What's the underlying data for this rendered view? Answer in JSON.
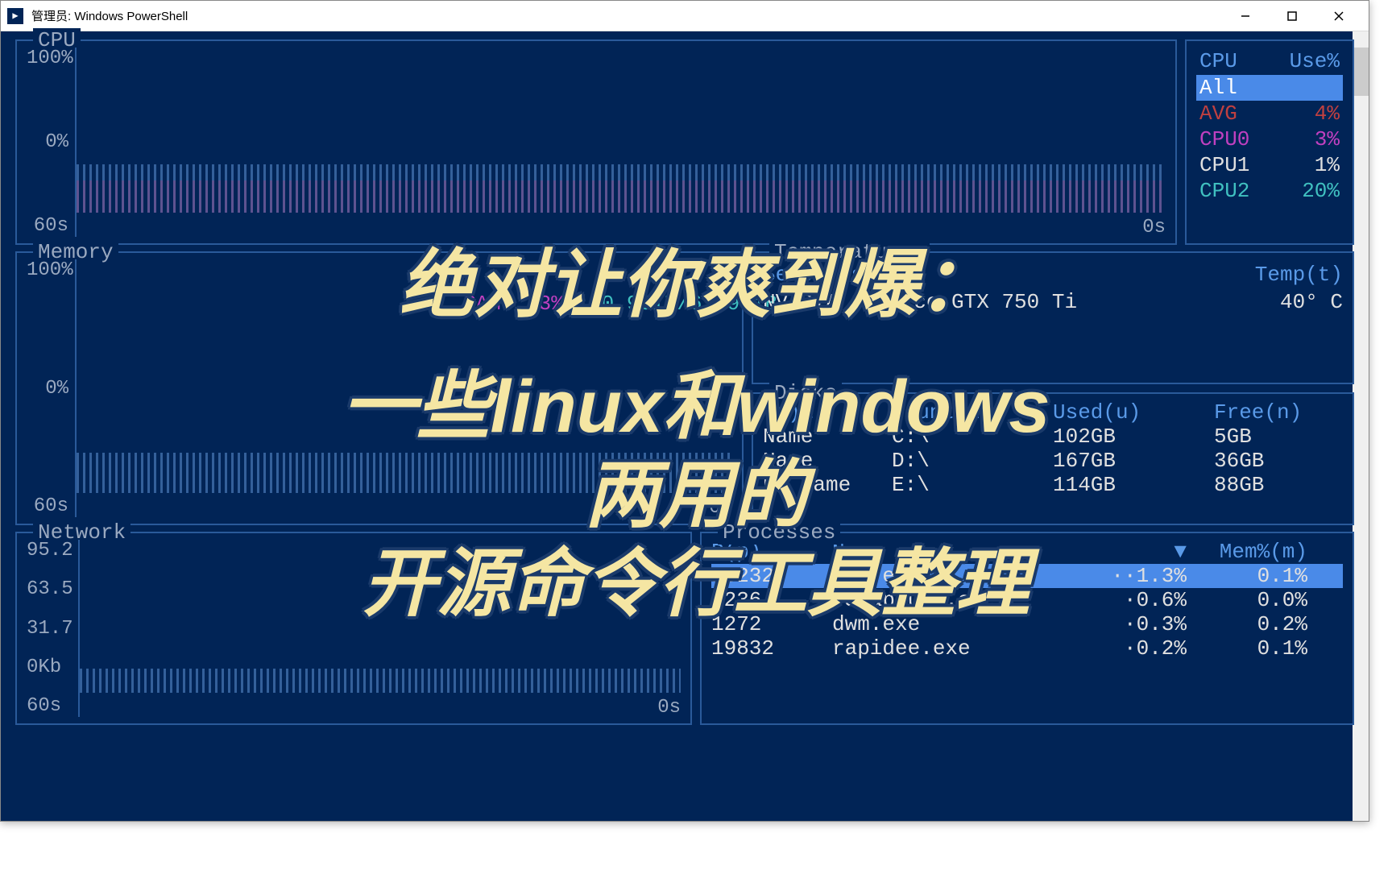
{
  "window": {
    "title": "管理员: Windows PowerShell"
  },
  "cpu": {
    "title": "CPU",
    "y_top": "100%",
    "y_bot": "0%",
    "x_left": "60s",
    "x_right": "0s"
  },
  "cpu_table": {
    "h1": "CPU",
    "h2": "Use%",
    "rows": [
      {
        "name": "All",
        "use": ""
      },
      {
        "name": "AVG",
        "use": "4%"
      },
      {
        "name": "CPU0",
        "use": "3%"
      },
      {
        "name": "CPU1",
        "use": "1%"
      },
      {
        "name": "CPU2",
        "use": "20%"
      }
    ]
  },
  "memory": {
    "title": "Memory",
    "y_top": "100%",
    "y_bot": "0%",
    "x_left": "60s",
    "x_right": "0s",
    "ram_label": "RAM",
    "ram_pct": "33%",
    "ram_val": "20.9GiB/63.9GiB"
  },
  "temps": {
    "title": "Temperatures",
    "h1": "Sensor(s)▲",
    "h2": "Temp(t)",
    "rows": [
      {
        "name": "NVIDIA GeForce GTX 750 Ti",
        "temp": "40° C"
      }
    ]
  },
  "disks": {
    "title": "Disks",
    "h1": "(d)▲",
    "h2": "Mount(m)",
    "h3": "Used(u)",
    "h4": "Free(n)",
    "rows": [
      {
        "name": "Name",
        "mount": "C:\\",
        "used": "102GB",
        "free": "5GB"
      },
      {
        "name": "Name",
        "mount": "D:\\",
        "used": "167GB",
        "free": "36GB"
      },
      {
        "name": "No Name",
        "mount": "E:\\",
        "used": "114GB",
        "free": "88GB"
      }
    ]
  },
  "network": {
    "title": "Network",
    "y1": "95.2",
    "y2": "63.5",
    "y3": "31.7",
    "y4": "0Kb",
    "x_left": "60s",
    "x_right": "0s"
  },
  "processes": {
    "title": "Processes",
    "h1": "P(p)",
    "h2": "Na",
    "h3": "▼",
    "h4": "Mem%(m)",
    "rows": [
      {
        "pid": "13232",
        "name": "btm.exe",
        "cpu": "··1.3%",
        "mem": "0.1%"
      },
      {
        "pid": "3236",
        "name": "FSCapture.exe",
        "cpu": "·0.6%",
        "mem": "0.0%"
      },
      {
        "pid": "1272",
        "name": "dwm.exe",
        "cpu": "·0.3%",
        "mem": "0.2%"
      },
      {
        "pid": "19832",
        "name": "rapidee.exe",
        "cpu": "·0.2%",
        "mem": "0.1%"
      }
    ]
  },
  "overlay": {
    "l1": "绝对让你爽到爆：",
    "l2": "一些linux和windows",
    "l3": "两用的",
    "l4": "开源命令行工具整理"
  }
}
